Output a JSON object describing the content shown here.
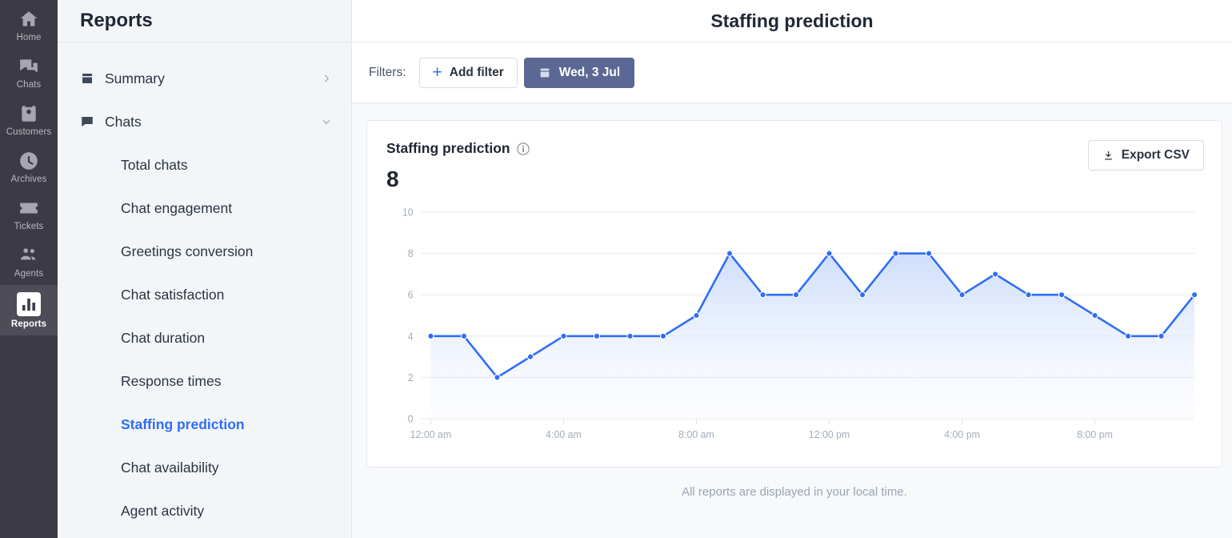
{
  "rail": {
    "items": [
      {
        "label": "Home",
        "icon": "home-icon",
        "active": false
      },
      {
        "label": "Chats",
        "icon": "chats-icon",
        "active": false
      },
      {
        "label": "Customers",
        "icon": "customers-icon",
        "active": false
      },
      {
        "label": "Archives",
        "icon": "clock-icon",
        "active": false
      },
      {
        "label": "Tickets",
        "icon": "ticket-icon",
        "active": false
      },
      {
        "label": "Agents",
        "icon": "agents-icon",
        "active": false
      },
      {
        "label": "Reports",
        "icon": "bar-chart-icon",
        "active": true
      }
    ]
  },
  "sidebar": {
    "title": "Reports",
    "groups": [
      {
        "label": "Summary",
        "icon": "calendar-icon",
        "chevron": "chevron-right-icon"
      },
      {
        "label": "Chats",
        "icon": "chat-bubble-icon",
        "chevron": "chevron-down-icon"
      }
    ],
    "items": [
      {
        "label": "Total chats",
        "active": false
      },
      {
        "label": "Chat engagement",
        "active": false
      },
      {
        "label": "Greetings conversion",
        "active": false
      },
      {
        "label": "Chat satisfaction",
        "active": false
      },
      {
        "label": "Chat duration",
        "active": false
      },
      {
        "label": "Response times",
        "active": false
      },
      {
        "label": "Staffing prediction",
        "active": true
      },
      {
        "label": "Chat availability",
        "active": false
      },
      {
        "label": "Agent activity",
        "active": false
      }
    ]
  },
  "header": {
    "title": "Staffing prediction"
  },
  "filters": {
    "label": "Filters:",
    "add_filter_label": "Add filter",
    "add_filter_icon": "plus-icon",
    "date_label": "Wed, 3 Jul",
    "date_icon": "calendar-icon"
  },
  "card": {
    "title": "Staffing prediction",
    "info_icon": "info-icon",
    "value": "8",
    "export_label": "Export CSV",
    "export_icon": "download-icon"
  },
  "footnote": "All reports are displayed in your local time.",
  "colors": {
    "accent": "#2f6df6",
    "line": "#2f6df6",
    "area_top": "#c6d8fb",
    "area_bottom": "#f4f7fe",
    "date_button": "#5c6894",
    "rail_bg": "#3c3b45",
    "sidebar_bg": "#f3f6f9"
  },
  "chart_data": {
    "type": "line",
    "title": "Staffing prediction",
    "xlabel": "",
    "ylabel": "",
    "ylim": [
      0,
      10
    ],
    "yticks": [
      0,
      2,
      4,
      6,
      8,
      10
    ],
    "xticks": [
      "12:00 am",
      "4:00 am",
      "8:00 am",
      "12:00 pm",
      "4:00 pm",
      "8:00 pm"
    ],
    "xtick_hours": [
      0,
      4,
      8,
      12,
      16,
      20
    ],
    "grid": true,
    "legend": false,
    "area_fill": true,
    "markers": true,
    "x": [
      "12:00 am",
      "1:00 am",
      "2:00 am",
      "3:00 am",
      "4:00 am",
      "5:00 am",
      "6:00 am",
      "7:00 am",
      "8:00 am",
      "9:00 am",
      "10:00 am",
      "11:00 am",
      "12:00 pm",
      "1:00 pm",
      "2:00 pm",
      "3:00 pm",
      "4:00 pm",
      "5:00 pm",
      "6:00 pm",
      "7:00 pm",
      "8:00 pm",
      "9:00 pm",
      "10:00 pm",
      "11:00 pm"
    ],
    "x_hours": [
      0,
      1,
      2,
      3,
      4,
      5,
      6,
      7,
      8,
      9,
      10,
      11,
      12,
      13,
      14,
      15,
      16,
      17,
      18,
      19,
      20,
      21,
      22,
      23
    ],
    "values": [
      4,
      4,
      2,
      3,
      4,
      4,
      4,
      4,
      5,
      8,
      6,
      6,
      8,
      6,
      8,
      8,
      6,
      7,
      6,
      6,
      5,
      4,
      4,
      6
    ],
    "series": [
      {
        "name": "Staffing prediction",
        "values": [
          4,
          4,
          2,
          3,
          4,
          4,
          4,
          4,
          5,
          8,
          6,
          6,
          8,
          6,
          8,
          8,
          6,
          7,
          6,
          6,
          5,
          4,
          4,
          6
        ]
      }
    ]
  }
}
